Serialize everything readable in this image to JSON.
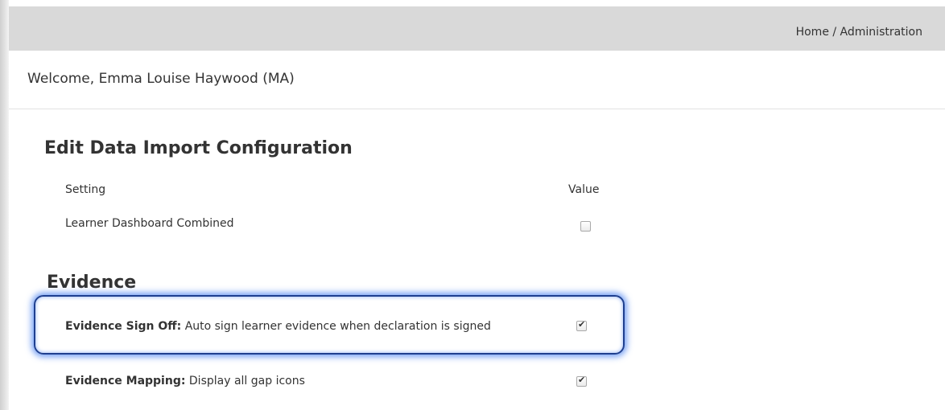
{
  "header": {
    "breadcrumb": "Home / Administration"
  },
  "welcome": {
    "text": "Welcome, Emma Louise Haywood (MA)"
  },
  "data_import": {
    "title": "Edit Data Import Configuration",
    "columns": {
      "setting": "Setting",
      "value": "Value"
    },
    "rows": [
      {
        "label": "Learner Dashboard Combined",
        "checked": false
      }
    ]
  },
  "evidence": {
    "title": "Evidence",
    "rows": [
      {
        "name": "Evidence Sign Off:",
        "description": "Auto sign learner evidence when declaration is signed",
        "checked": true,
        "highlighted": true
      },
      {
        "name": "Evidence Mapping:",
        "description": "Display all gap icons",
        "checked": true,
        "highlighted": false
      }
    ]
  },
  "colors": {
    "header_background": "#d9d9d9",
    "highlight_border": "#1e3f8f",
    "highlight_glow": "#4a81f0"
  }
}
